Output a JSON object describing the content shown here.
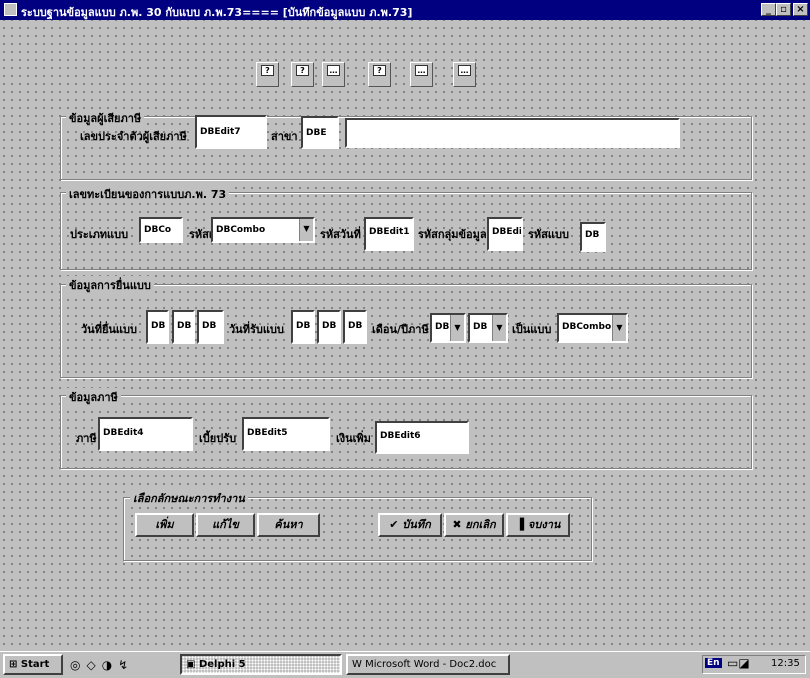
{
  "window": {
    "title": "ระบบฐานข้อมูลแบบ ภ.พ. 30 กับแบบ ภ.พ.73==== [บันทึกข้อมูลแบบ ภ.พ.73]",
    "minimize": "_",
    "restore": "▫",
    "close": "×"
  },
  "toolbar": {
    "buttons": [
      {
        "icon": "first-record-icon",
        "glyph": "?"
      },
      {
        "icon": "prior-record-icon",
        "glyph": "?"
      },
      {
        "icon": "next-record-icon",
        "glyph": "…"
      },
      {
        "icon": "last-record-icon",
        "glyph": "?"
      },
      {
        "icon": "refresh-icon",
        "glyph": "…"
      },
      {
        "icon": "post-icon",
        "glyph": "…"
      }
    ]
  },
  "group1": {
    "legend": "ข้อมูลผู้เสียภาษี",
    "taxid_label": "เลขประจำตัวผู้เสียภาษี",
    "taxid_value": "DBEdit7",
    "branch_label": "สาขา",
    "branch_value": "DBE",
    "name_value": ""
  },
  "group2": {
    "legend": "เลขทะเบียนของการแบบภ.พ. 73",
    "type_label": "ประเภทแบบ",
    "type_value": "DBCo",
    "area_label": "รหัสเขต",
    "area_value": "DBCombo",
    "date_label": "รหัสวันที่",
    "date_value": "DBEdit1",
    "group_label": "รหัสกลุ่มข้อมูล",
    "group_value": "DBEdit",
    "form_label": "รหัสแบบ",
    "form_value": "DB"
  },
  "group3": {
    "legend": "ข้อมูลการยื่นแบบ",
    "submit_label": "วันที่ยื่นแบบ",
    "submit_d": "DB",
    "submit_m": "DB",
    "submit_y": "DB",
    "receive_label": "วันที่รับแบบ",
    "receive_d": "DB",
    "receive_m": "DB",
    "receive_y": "DB",
    "period_label": "เดือน/ปีภาษี",
    "period_month": "DB",
    "period_year": "DB",
    "kind_label": "เป็นแบบ",
    "kind_value": "DBCombo"
  },
  "group4": {
    "legend": "ข้อมูลภาษี",
    "tax_label": "ภาษี",
    "tax_value": "DBEdit4",
    "fine_label": "เบี้ยปรับ",
    "fine_value": "DBEdit5",
    "surcharge_label": "เงินเพิ่ม",
    "surcharge_value": "DBEdit6"
  },
  "actions": {
    "legend": "เลือกลักษณะการทำงาน",
    "add": "เพิ่ม",
    "edit": "แก้ไข",
    "search": "ค้นหา",
    "save": "บันทึก",
    "cancel": "ยกเลิก",
    "exit": "จบงาน"
  },
  "taskbar": {
    "start": "Start",
    "task1": "Delphi 5",
    "task2": "Microsoft Word - Doc2.doc",
    "lang": "En",
    "time": "12:35"
  }
}
